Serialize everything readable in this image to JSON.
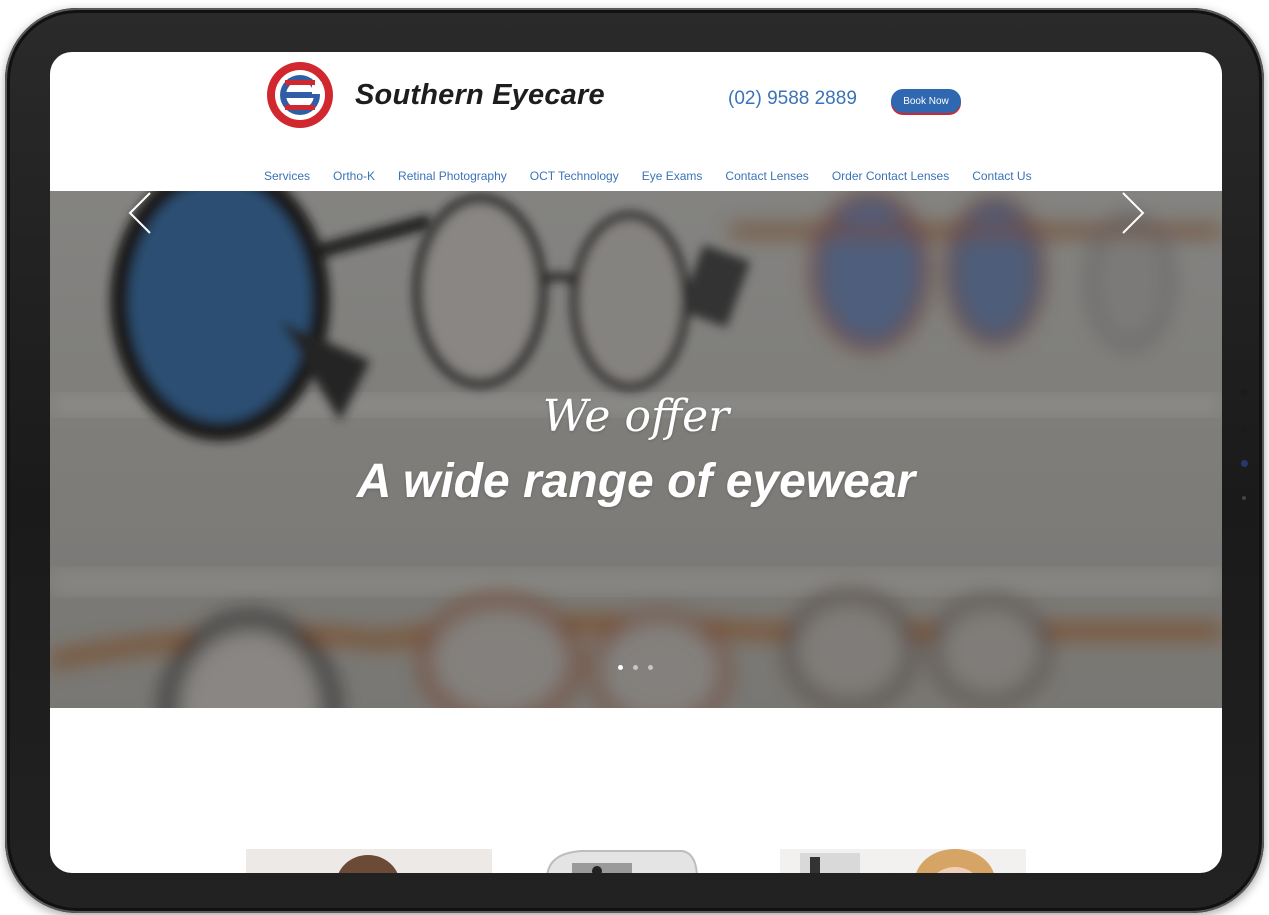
{
  "header": {
    "brand": "Southern Eyecare",
    "phone": "(02) 9588 2889",
    "book_button": "Book Now"
  },
  "nav": {
    "items": [
      "Services",
      "Ortho-K",
      "Retinal Photography",
      "OCT Technology",
      "Eye Exams",
      "Contact Lenses",
      "Order Contact Lenses",
      "Contact Us"
    ]
  },
  "hero": {
    "subtitle": "We offer",
    "title": "A wide range of eyewear",
    "slides_total": 3,
    "active_slide": 1
  },
  "icons": {
    "logo": "southern-eyecare-logo",
    "prev": "chevron-left-icon",
    "next": "chevron-right-icon"
  },
  "colors": {
    "accent_blue": "#3b73b6",
    "button_blue": "#2f67b0",
    "brand_red": "#d0282e",
    "device_frame": "#1e1e1e"
  }
}
